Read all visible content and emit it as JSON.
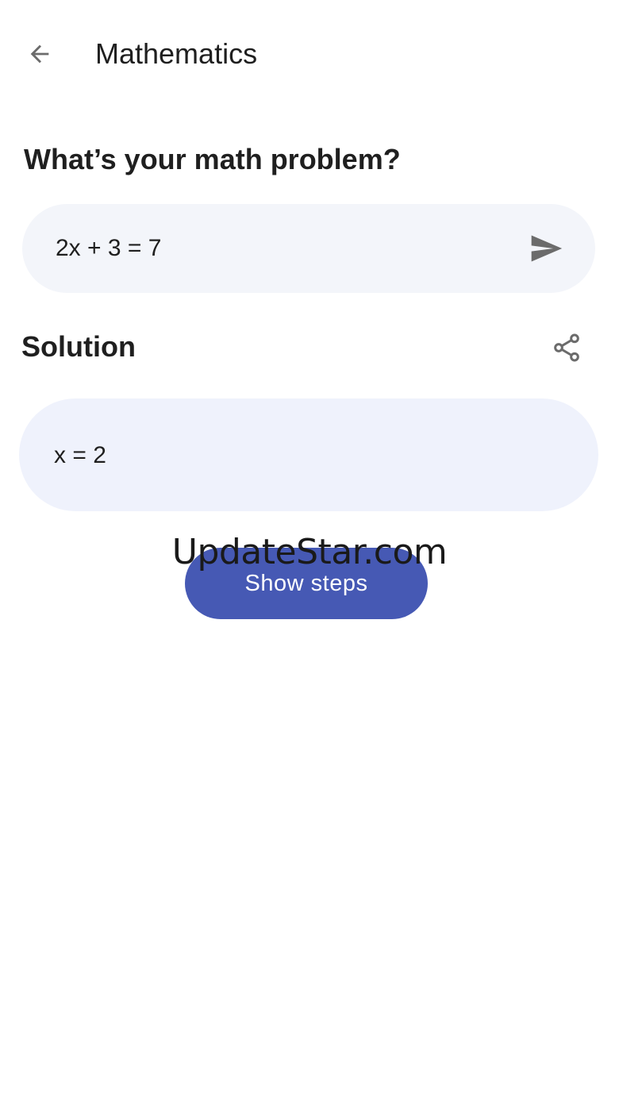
{
  "app_bar": {
    "title": "Mathematics",
    "back_icon": "arrow-left-icon"
  },
  "problem": {
    "heading": "What’s your math problem?",
    "input_value": "2x + 3 = 7",
    "send_icon": "send-icon"
  },
  "solution": {
    "heading": "Solution",
    "share_icon": "share-icon",
    "result": "x = 2"
  },
  "actions": {
    "show_steps_label": "Show steps"
  },
  "watermark": {
    "text": "UpdateStar.com"
  },
  "colors": {
    "accent": "#4659b4",
    "input_background": "#f3f5fa",
    "card_background": "#eff2fc",
    "icon": "#6b6b6b",
    "text": "#1f1f1f"
  }
}
